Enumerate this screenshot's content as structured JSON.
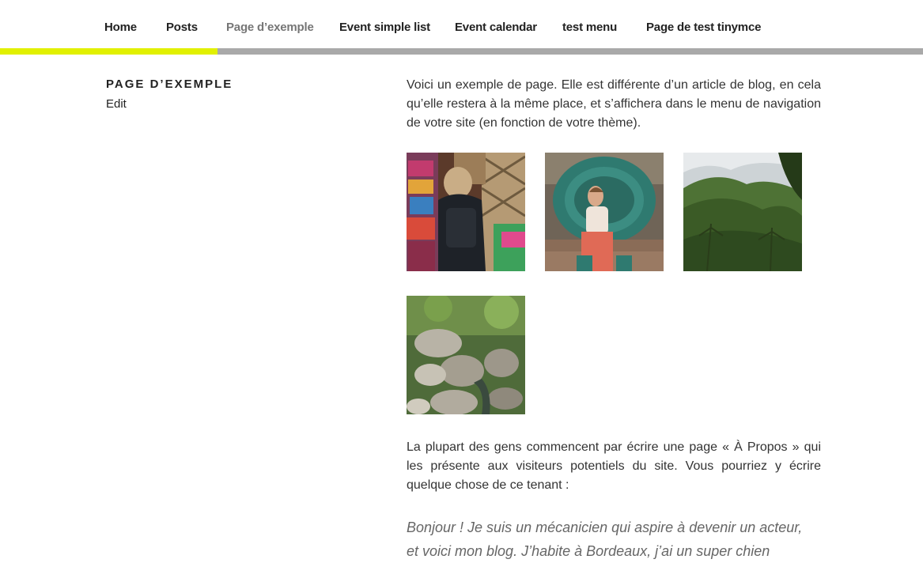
{
  "nav": {
    "items": [
      {
        "label": "Home"
      },
      {
        "label": "Posts"
      },
      {
        "label": "Page d’exemple",
        "current": true
      },
      {
        "label": "Event simple list"
      },
      {
        "label": "Event calendar"
      },
      {
        "label": "test menu"
      },
      {
        "label": "Page de test tinymce"
      }
    ],
    "accent_color": "#e1f000",
    "bar_color": "#a9a9a9"
  },
  "page": {
    "title": "Page d’exemple",
    "edit_label": "Edit",
    "intro": "Voici un exemple de page. Elle est différente d’un article de blog, en cela qu’elle restera à la même place, et s’affichera dans le menu de navigation de votre site (en fonction de votre thème).",
    "gallery": [
      {
        "subject": "market-stall-photo"
      },
      {
        "subject": "woman-in-peacock-chair-photo"
      },
      {
        "subject": "green-valley-photo"
      },
      {
        "subject": "river-rocks-photo"
      }
    ],
    "about_text": "La plupart des gens commencent par écrire une page « À Propos » qui les présente aux visiteurs potentiels du site. Vous pourriez y écrire quelque chose de ce tenant :",
    "quote_line1": "Bonjour ! Je suis un mécanicien qui aspire à devenir un acteur,",
    "quote_line2": "et voici mon blog. J’habite à Bordeaux, j’ai un super chien"
  }
}
